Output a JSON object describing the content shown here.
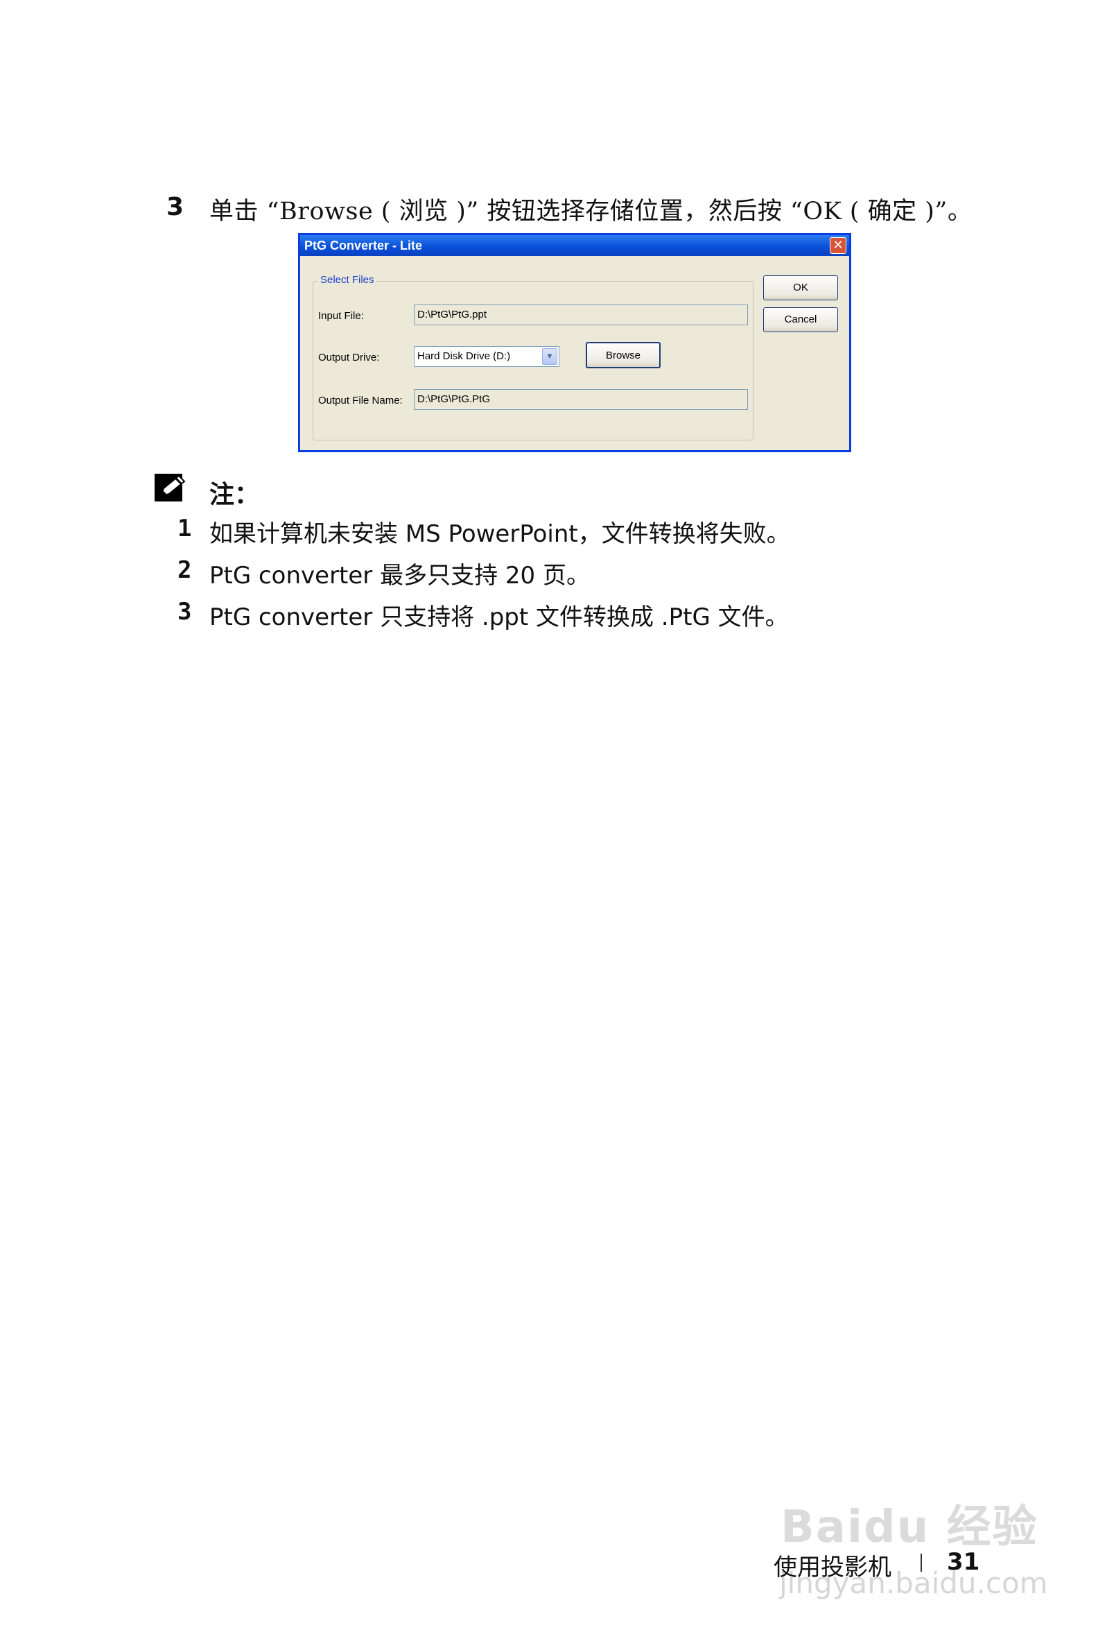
{
  "step": {
    "number": "3",
    "text": "单击 “Browse ( 浏览 )” 按钮选择存储位置，然后按 “OK ( 确定 )”。"
  },
  "dialog": {
    "title": "PtG Converter - Lite",
    "close_symbol": "✕",
    "group_title": "Select Files",
    "input_file_label": "Input File:",
    "input_file_value": "D:\\PtG\\PtG.ppt",
    "output_drive_label": "Output Drive:",
    "output_drive_value": "Hard Disk Drive (D:)",
    "browse_label": "Browse",
    "output_name_label": "Output File Name:",
    "output_name_value": "D:\\PtG\\PtG.PtG",
    "ok_label": "OK",
    "cancel_label": "Cancel"
  },
  "note": {
    "title": "注：",
    "items": [
      {
        "num": "1",
        "text": "如果计算机未安装 MS PowerPoint，文件转换将失败。"
      },
      {
        "num": "2",
        "text": "PtG converter 最多只支持 20 页。"
      },
      {
        "num": "3",
        "text": "PtG converter 只支持将 .ppt 文件转换成 .PtG 文件。"
      }
    ]
  },
  "footer": {
    "label": "使用投影机",
    "page": "31"
  },
  "watermark": {
    "logo_text": "Baidu 经验",
    "url": "jingyan.baidu.com"
  }
}
